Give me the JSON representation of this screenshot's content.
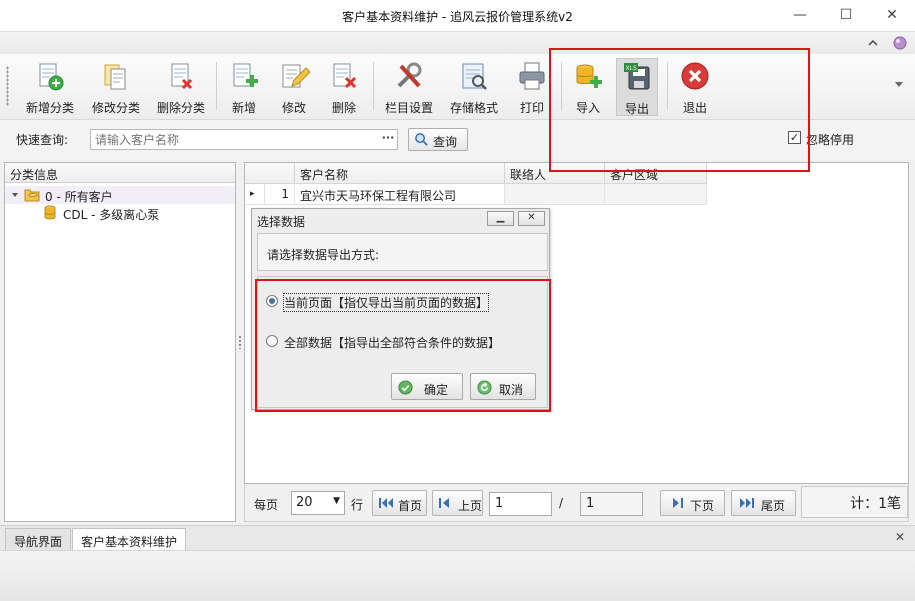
{
  "window": {
    "title": "客户基本资料维护 - 追风云报价管理系统v2",
    "minimize": "—",
    "maximize": "☐",
    "close": "✕"
  },
  "toolbar": {
    "items": [
      {
        "label": "新增分类",
        "icon": "add-category-icon"
      },
      {
        "label": "修改分类",
        "icon": "edit-category-icon"
      },
      {
        "label": "删除分类",
        "icon": "delete-category-icon"
      },
      {
        "label": "新增",
        "icon": "add-icon"
      },
      {
        "label": "修改",
        "icon": "edit-icon"
      },
      {
        "label": "删除",
        "icon": "delete-icon"
      },
      {
        "label": "栏目设置",
        "icon": "tools-icon"
      },
      {
        "label": "存储格式",
        "icon": "save-format-icon"
      },
      {
        "label": "打印",
        "icon": "printer-icon"
      },
      {
        "label": "导入",
        "icon": "import-database-icon"
      },
      {
        "label": "导出",
        "icon": "export-xls-icon"
      },
      {
        "label": "退出",
        "icon": "exit-icon"
      }
    ]
  },
  "search": {
    "label": "快速查询:",
    "placeholder": "请输入客户名称",
    "ellipsis": "···",
    "button": "查询",
    "ignore_disabled_label": "忽略停用",
    "ignore_disabled_checked": "✓"
  },
  "tree": {
    "header": "分类信息",
    "items": [
      {
        "label": "0 - 所有客户"
      },
      {
        "label": "CDL - 多级离心泵"
      }
    ]
  },
  "grid": {
    "columns": [
      "客户名称",
      "联络人",
      "客户区域"
    ],
    "rows": [
      {
        "indicator": "▸",
        "num": "1",
        "name": "宜兴市天马环保工程有限公司",
        "contact": "",
        "region": ""
      }
    ]
  },
  "pager": {
    "per_page_label": "每页",
    "per_page_value": "20",
    "rows_label": "行",
    "first": "首页",
    "prev": "上页",
    "page": "1",
    "slash": "/",
    "total_pages": "1",
    "next": "下页",
    "last": "尾页",
    "count": "计：1笔"
  },
  "tabs": {
    "items": [
      "导航界面",
      "客户基本资料维护"
    ],
    "close": "✕"
  },
  "dialog": {
    "title": "选择数据",
    "prompt": "请选择数据导出方式:",
    "option_current": "当前页面【指仅导出当前页面的数据】",
    "option_all": "全部数据【指导出全部符合条件的数据】",
    "ok": "确定",
    "cancel": "取消",
    "min": "▁",
    "close": "✕"
  },
  "colors": {
    "highlight": "#d81818",
    "accent": "#4a6fa5"
  }
}
